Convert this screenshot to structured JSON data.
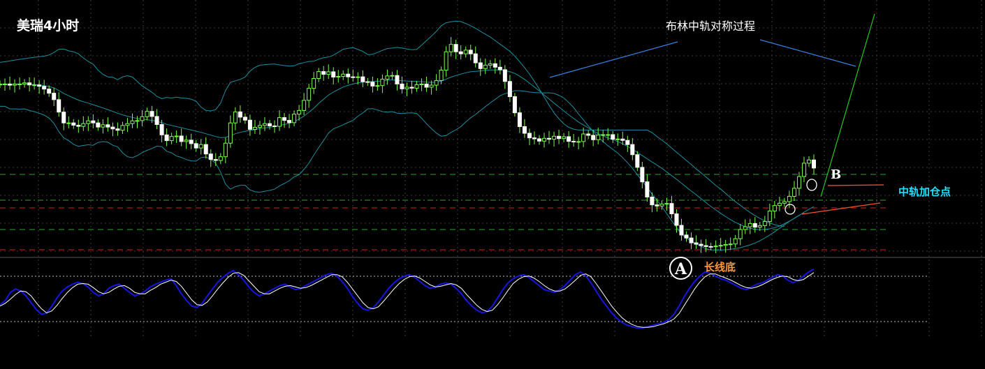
{
  "title": "美瑞4小时",
  "annotations": {
    "symmetry": "布林中轨对称过程",
    "mid_add": "中轨加仓点",
    "long_bottom": "长线底",
    "mark_a": "A",
    "mark_b": "B"
  },
  "colors": {
    "background": "#000000",
    "grid": "#3a3a3a",
    "candle": "#7cff4a",
    "bollinger": "#1d8f9e",
    "support_green": "#2aa52a",
    "support_red": "#d02020",
    "dotted_white": "#bbbbbb",
    "stoch_k": "#1515e0",
    "stoch_d": "#ffffff",
    "trend_blue": "#3b7fe0",
    "trend_green": "#22cc22",
    "trend_orange": "#ff5030"
  },
  "chart_data": [
    {
      "type": "candlestick",
      "name": "price",
      "y_range": [
        0,
        100
      ],
      "x_count": 120,
      "closes": [
        72.5,
        72.6,
        72.1,
        72.6,
        72.6,
        73.1,
        72.2,
        72.2,
        71.6,
        70.4,
        68.6,
        65.8,
        60.4,
        55.7,
        55.7,
        54.7,
        54.2,
        55.4,
        56.6,
        55.7,
        53.9,
        54.9,
        53.9,
        53.1,
        52.5,
        54.6,
        55.4,
        56.6,
        56.7,
        58.4,
        60.7,
        58.5,
        55.0,
        50.5,
        48.0,
        49.8,
        50.0,
        47.6,
        48.2,
        46.7,
        44.8,
        46.3,
        42.2,
        39.8,
        39.4,
        41.0,
        46.9,
        55.7,
        60.5,
        58.2,
        56.9,
        52.9,
        53.8,
        54.6,
        55.4,
        54.4,
        54.2,
        58.0,
        56.8,
        55.8,
        59.5,
        61.1,
        65.5,
        70.7,
        75.0,
        78.0,
        76.8,
        77.9,
        75.6,
        75.9,
        76.9,
        75.7,
        75.6,
        75.7,
        73.6,
        73.4,
        71.7,
        71.9,
        74.7,
        76.1,
        76.3,
        72.6,
        70.5,
        71.2,
        70.8,
        72.3,
        72.6,
        71.2,
        72.1,
        74.1,
        78.6,
        86.6,
        89.8,
        86.6,
        85.7,
        87.3,
        85.7,
        81.8,
        79.3,
        80.8,
        81.4,
        79.9,
        78.8,
        73.7,
        67.1,
        60.1,
        54.1,
        51.2,
        49.2,
        48.8,
        47.8,
        49.0,
        48.6,
        49.9,
        48.9,
        49.7,
        47.7,
        47.4,
        47.6,
        50.9,
        50.3,
        48.4,
        50.4,
        50.6,
        50.6,
        48.6,
        48.7,
        48.1,
        46.3,
        41.9,
        36.4,
        30.1,
        23.5,
        20.1,
        19.6,
        20.4,
        20.7,
        16.2,
        11.2,
        7.0,
        5.7,
        3.6,
        3.0,
        2.4,
        2.0,
        1.9,
        2.2,
        2.5,
        2.9,
        3.1,
        5.4,
        9.4,
        10.6,
        12.0,
        10.4,
        11.1,
        12.9,
        17.4,
        19.8,
        20.8,
        21.5,
        23.8,
        27.3,
        32.4,
        38.2,
        39.6,
        36.1
      ],
      "bollinger": {
        "upper": [
          82.0,
          82.3,
          82.6,
          83.0,
          83.3,
          83.6,
          83.9,
          84.2,
          84.5,
          84.7,
          85.2,
          86.3,
          87.7,
          87.8,
          87.0,
          86.6,
          85.7,
          83.9,
          82.4,
          81.2,
          78.6,
          76.8,
          75.7,
          75.5,
          74.5,
          75.7,
          76.2,
          75.6,
          73.7,
          71.8,
          70.4,
          69.0,
          67.2,
          66.2,
          66.8,
          66.5,
          66.9,
          66.5,
          66.4,
          66.0,
          65.1,
          62.6,
          61.1,
          60.9,
          61.5,
          64.3,
          69.7,
          73.3,
          74.0,
          74.6,
          75.6,
          78.2,
          79.8,
          80.8,
          81.0,
          81.2,
          81.3,
          80.9,
          80.6,
          80.4,
          80.5,
          81.4,
          81.9,
          82.4,
          82.5,
          83.4,
          84.0,
          84.3,
          85.1,
          86.4,
          87.7,
          88.1,
          88.4,
          87.6,
          86.8,
          85.4,
          85.5,
          86.3,
          87.2,
          88.0,
          88.2,
          88.5,
          88.2,
          87.8,
          87.5,
          87.6,
          89.5,
          91.5,
          93.4,
          95.5,
          97.9,
          99.2,
          99.6,
          99.9,
          99.7,
          98.9,
          97.9,
          96.8,
          95.5,
          94.2,
          93.0,
          91.5,
          89.9,
          88.4,
          86.8,
          84.7,
          82.3,
          79.7,
          76.9,
          73.7,
          70.4,
          66.9,
          63.4,
          60.1,
          57.5,
          55.3,
          53.8,
          53.0,
          52.6,
          52.6,
          52.6,
          52.6,
          52.6,
          52.6,
          52.6,
          52.6,
          52.6,
          52.6,
          52.6,
          52.6,
          52.6,
          52.6,
          52.6,
          51.5,
          49.8,
          48.2,
          46.6,
          44.8,
          42.9,
          41.2,
          39.4,
          37.6,
          35.7,
          34.0,
          32.2,
          30.4,
          28.5,
          26.9,
          25.1,
          23.2,
          21.5,
          19.9,
          18.3,
          16.8,
          15.4,
          14.2,
          13.1,
          12.2,
          11.5,
          11.0,
          10.8
        ],
        "middle": [
          72.5,
          72.6,
          72.2,
          72.4,
          72.5,
          72.7,
          72.5,
          72.4,
          72.2,
          71.9,
          71.5,
          70.9,
          69.8,
          68.5,
          67.5,
          66.5,
          65.6,
          64.9,
          64.3,
          63.6,
          62.9,
          62.2,
          61.5,
          60.7,
          59.9,
          59.2,
          58.6,
          58.1,
          57.6,
          57.3,
          57.1,
          56.8,
          56.4,
          55.8,
          55.1,
          54.6,
          54.1,
          53.6,
          53.1,
          52.6,
          52.1,
          51.6,
          51.0,
          50.4,
          49.8,
          49.3,
          49.4,
          50.1,
          51.0,
          51.6,
          52.1,
          52.4,
          52.8,
          53.2,
          53.5,
          53.8,
          54.1,
          54.6,
          55.0,
          55.5,
          56.4,
          57.3,
          58.7,
          60.3,
          62.1,
          64.2,
          66.0,
          67.8,
          69.1,
          70.2,
          71.3,
          72.0,
          72.6,
          73.1,
          73.4,
          73.6,
          73.7,
          73.8,
          73.9,
          74.2,
          74.4,
          74.2,
          74.0,
          73.9,
          73.8,
          73.7,
          73.6,
          73.4,
          73.3,
          73.4,
          73.9,
          74.7,
          75.6,
          76.3,
          76.9,
          77.5,
          77.9,
          78.1,
          78.3,
          78.5,
          78.7,
          78.7,
          78.7,
          78.4,
          77.9,
          77.2,
          76.0,
          74.6,
          73.0,
          71.3,
          69.6,
          67.8,
          66.1,
          64.3,
          62.6,
          60.9,
          59.2,
          57.7,
          56.1,
          54.8,
          53.5,
          52.3,
          51.1,
          50.1,
          49.2,
          48.4,
          47.6,
          46.6,
          45.5,
          44.3,
          42.9,
          41.5,
          40.1,
          38.7,
          37.4,
          36.0,
          34.4,
          32.8,
          31.2,
          29.5,
          27.8,
          26.1,
          24.5,
          22.8,
          21.1,
          19.4,
          17.9,
          16.4,
          15.0,
          13.7,
          12.5,
          11.5,
          10.6,
          9.9,
          9.5,
          9.3,
          9.4,
          9.7,
          10.2,
          10.9,
          11.9,
          13.0,
          14.2,
          15.5,
          16.9,
          18.2,
          19.3
        ],
        "lower": [
          62.9,
          62.9,
          61.8,
          61.8,
          61.7,
          61.8,
          61.1,
          60.6,
          59.9,
          59.1,
          57.8,
          55.5,
          51.9,
          49.2,
          48.0,
          46.4,
          45.5,
          45.9,
          46.2,
          46.0,
          47.2,
          47.6,
          47.3,
          46.0,
          45.3,
          42.7,
          41.0,
          40.6,
          41.5,
          42.8,
          43.8,
          44.6,
          45.6,
          45.4,
          43.4,
          42.7,
          41.3,
          40.7,
          39.8,
          39.2,
          39.1,
          40.6,
          40.9,
          39.9,
          38.1,
          34.3,
          29.1,
          26.9,
          28.0,
          28.6,
          28.6,
          26.6,
          25.8,
          25.6,
          26.0,
          26.4,
          26.9,
          28.3,
          29.4,
          30.6,
          32.3,
          33.2,
          35.5,
          38.2,
          41.7,
          45.0,
          48.0,
          51.3,
          53.1,
          54.0,
          54.9,
          55.9,
          56.8,
          58.6,
          60.0,
          61.8,
          61.9,
          61.3,
          60.6,
          60.4,
          60.6,
          59.9,
          59.8,
          60.0,
          60.1,
          59.8,
          57.7,
          55.3,
          53.2,
          51.3,
          49.9,
          50.2,
          51.6,
          52.7,
          54.1,
          56.1,
          57.9,
          59.4,
          61.1,
          62.8,
          64.4,
          65.9,
          67.5,
          68.4,
          69.0,
          69.7,
          69.7,
          69.5,
          69.1,
          68.9,
          68.8,
          68.7,
          68.8,
          68.5,
          67.7,
          66.5,
          64.6,
          62.4,
          59.6,
          57.0,
          54.4,
          52.0,
          49.6,
          47.6,
          45.8,
          44.2,
          42.6,
          40.6,
          38.4,
          36.0,
          33.2,
          30.4,
          27.6,
          24.8,
          22.1,
          19.4,
          16.2,
          13.2,
          10.2,
          7.4,
          5.6,
          4.3,
          3.1,
          2.1,
          1.0,
          0.6,
          0.5,
          0.5,
          0.6,
          0.8,
          1.1,
          1.5,
          2.1,
          2.7,
          3.5,
          4.5,
          5.7,
          7.0,
          8.4,
          9.9,
          11.4,
          12.9,
          14.3,
          15.6,
          16.7
        ]
      }
    },
    {
      "type": "line",
      "name": "stochastic",
      "y_range": [
        0,
        100
      ],
      "series": [
        {
          "key": "k",
          "values": [
            42,
            48,
            60,
            65,
            62,
            55,
            45,
            35,
            28,
            30,
            40,
            52,
            62,
            68,
            72,
            75,
            73,
            68,
            60,
            55,
            58,
            66,
            70,
            72,
            66,
            60,
            55,
            58,
            62,
            68,
            72,
            75,
            78,
            80,
            70,
            58,
            48,
            40,
            38,
            44,
            55,
            65,
            75,
            82,
            88,
            92,
            86,
            78,
            68,
            60,
            55,
            58,
            62,
            66,
            70,
            72,
            68,
            64,
            66,
            70,
            74,
            78,
            82,
            86,
            88,
            84,
            76,
            66,
            54,
            44,
            36,
            34,
            38,
            46,
            56,
            66,
            74,
            80,
            84,
            86,
            82,
            76,
            70,
            66,
            68,
            72,
            74,
            72,
            66,
            58,
            48,
            40,
            34,
            30,
            32,
            40,
            52,
            64,
            74,
            80,
            84,
            86,
            82,
            76,
            70,
            64,
            62,
            60,
            64,
            70,
            78,
            86,
            90,
            84,
            74,
            62,
            50,
            40,
            30,
            22,
            16,
            12,
            10,
            8,
            8,
            10,
            12,
            14,
            16,
            20,
            28,
            40,
            54,
            66,
            76,
            84,
            90,
            88,
            84,
            80,
            78,
            74,
            70,
            66,
            64,
            68,
            72,
            74,
            78,
            82,
            86,
            84,
            78,
            74,
            78,
            84,
            90,
            94
          ]
        },
        {
          "key": "d",
          "values": [
            40,
            44,
            50,
            57,
            62,
            61,
            55,
            45,
            36,
            30,
            33,
            41,
            51,
            60,
            67,
            72,
            73,
            72,
            67,
            61,
            58,
            60,
            65,
            69,
            70,
            66,
            60,
            58,
            58,
            63,
            67,
            72,
            75,
            78,
            76,
            69,
            59,
            49,
            42,
            41,
            46,
            55,
            65,
            74,
            82,
            88,
            89,
            85,
            77,
            69,
            61,
            58,
            58,
            62,
            66,
            69,
            70,
            68,
            66,
            67,
            70,
            74,
            78,
            82,
            86,
            86,
            83,
            75,
            65,
            55,
            45,
            38,
            36,
            39,
            47,
            56,
            65,
            73,
            79,
            83,
            84,
            81,
            76,
            71,
            68,
            69,
            71,
            73,
            71,
            66,
            57,
            49,
            41,
            35,
            32,
            34,
            42,
            52,
            63,
            73,
            79,
            83,
            84,
            81,
            76,
            70,
            65,
            62,
            62,
            65,
            71,
            78,
            85,
            87,
            83,
            73,
            62,
            51,
            40,
            31,
            23,
            17,
            13,
            10,
            9,
            9,
            10,
            12,
            14,
            17,
            21,
            29,
            41,
            53,
            65,
            75,
            83,
            87,
            87,
            84,
            81,
            78,
            74,
            70,
            67,
            66,
            68,
            71,
            75,
            79,
            82,
            84,
            83,
            79,
            77,
            79,
            84,
            89
          ]
        }
      ]
    }
  ]
}
